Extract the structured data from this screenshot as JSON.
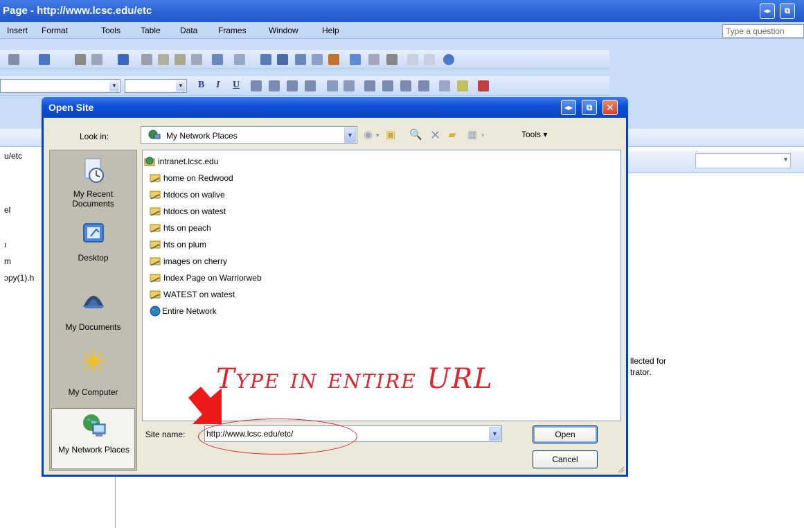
{
  "app": {
    "title": "Page - http://www.lcsc.edu/etc",
    "menu": [
      "Insert",
      "Format",
      "Tools",
      "Table",
      "Data",
      "Frames",
      "Window",
      "Help"
    ],
    "question_placeholder": "Type a question"
  },
  "background_text": {
    "left": [
      "u/etc",
      "el",
      "ı",
      "m",
      "ɔpy(1).h"
    ],
    "right_line1": "llected for",
    "right_line2": "trator."
  },
  "dialog": {
    "title": "Open Site",
    "look_in_label": "Look in:",
    "look_in_value": "My Network Places",
    "tools_label": "Tools ▾",
    "places": [
      {
        "label": "My Recent Documents",
        "icon": "recent-documents-icon"
      },
      {
        "label": "Desktop",
        "icon": "desktop-icon"
      },
      {
        "label": "My Documents",
        "icon": "my-documents-icon"
      },
      {
        "label": "My Computer",
        "icon": "my-computer-icon"
      },
      {
        "label": "My Network Places",
        "icon": "network-places-icon"
      }
    ],
    "files": [
      {
        "label": "intranet.lcsc.edu",
        "icon": "web-folder-icon"
      },
      {
        "label": "home on Redwood",
        "icon": "network-share-icon"
      },
      {
        "label": "htdocs on walive",
        "icon": "network-share-icon"
      },
      {
        "label": "htdocs on watest",
        "icon": "network-share-icon"
      },
      {
        "label": "hts on peach",
        "icon": "network-share-icon"
      },
      {
        "label": "hts on plum",
        "icon": "network-share-icon"
      },
      {
        "label": "images on cherry",
        "icon": "network-share-icon"
      },
      {
        "label": "Index Page on Warriorweb",
        "icon": "network-share-icon"
      },
      {
        "label": "WATEST on watest",
        "icon": "network-share-icon"
      },
      {
        "label": "Entire Network",
        "icon": "globe-icon"
      }
    ],
    "site_name_label": "Site name:",
    "site_name_value": "http://www.lcsc.edu/etc/",
    "open_label": "Open",
    "cancel_label": "Cancel"
  },
  "annotation": {
    "text": "Type in entire URL",
    "color": "#d9262f"
  }
}
